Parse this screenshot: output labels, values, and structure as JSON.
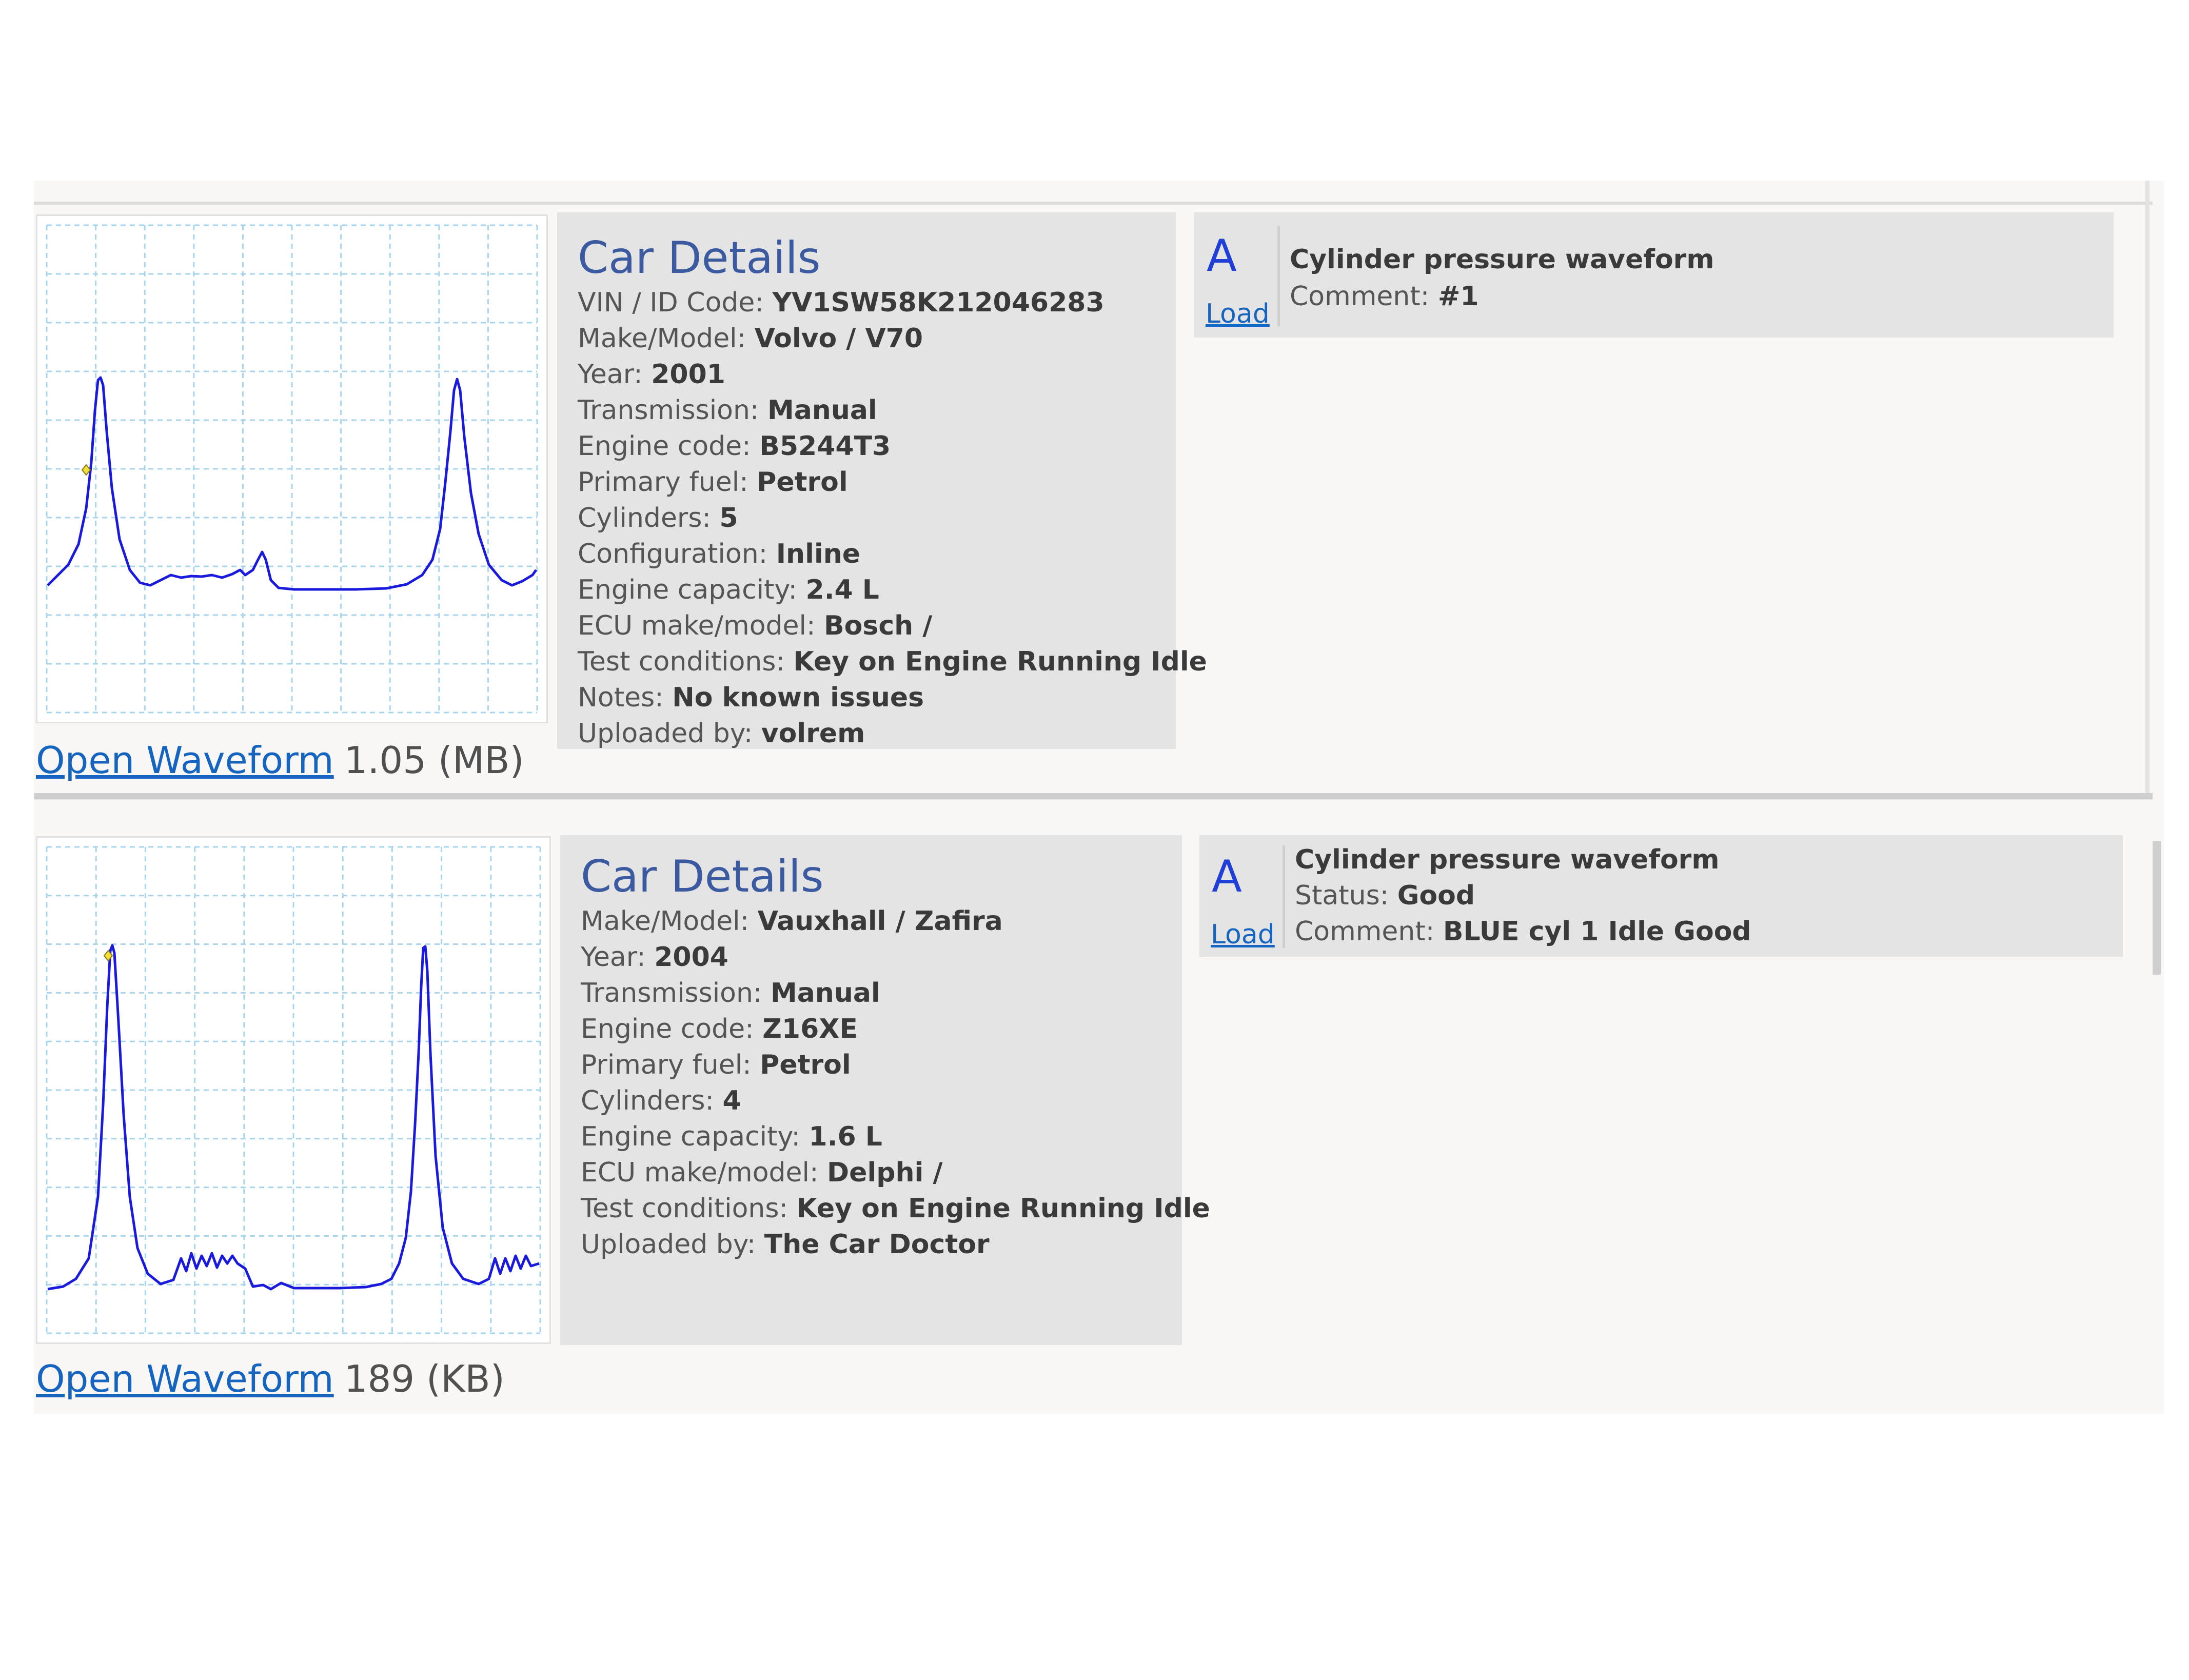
{
  "records": [
    {
      "waveform": {
        "open_label": "Open Waveform",
        "size": "1.05 (MB)"
      },
      "details": {
        "heading": "Car Details",
        "fields": [
          {
            "label": "VIN / ID Code:",
            "value": "YV1SW58K212046283"
          },
          {
            "label": "Make/Model:",
            "value": "Volvo / V70"
          },
          {
            "label": "Year:",
            "value": "2001"
          },
          {
            "label": "Transmission:",
            "value": "Manual"
          },
          {
            "label": "Engine code:",
            "value": "B5244T3"
          },
          {
            "label": "Primary fuel:",
            "value": "Petrol"
          },
          {
            "label": "Cylinders:",
            "value": "5"
          },
          {
            "label": "Configuration:",
            "value": "Inline"
          },
          {
            "label": "Engine capacity:",
            "value": "2.4 L"
          },
          {
            "label": "ECU make/model:",
            "value": "Bosch /"
          },
          {
            "label": "Test conditions:",
            "value": "Key on Engine Running Idle"
          },
          {
            "label": "Notes:",
            "value": "No known issues"
          },
          {
            "label": "Uploaded by:",
            "value": "volrem"
          }
        ]
      },
      "test": {
        "channel": "A",
        "load_label": "Load",
        "title": "Cylinder pressure waveform",
        "fields": [
          {
            "label": "Comment:",
            "value": "#1"
          }
        ]
      }
    },
    {
      "waveform": {
        "open_label": "Open Waveform",
        "size": "189 (KB)"
      },
      "details": {
        "heading": "Car Details",
        "fields": [
          {
            "label": "Make/Model:",
            "value": "Vauxhall / Zafira"
          },
          {
            "label": "Year:",
            "value": "2004"
          },
          {
            "label": "Transmission:",
            "value": "Manual"
          },
          {
            "label": "Engine code:",
            "value": "Z16XE"
          },
          {
            "label": "Primary fuel:",
            "value": "Petrol"
          },
          {
            "label": "Cylinders:",
            "value": "4"
          },
          {
            "label": "Engine capacity:",
            "value": "1.6 L"
          },
          {
            "label": "ECU make/model:",
            "value": "Delphi /"
          },
          {
            "label": "Test conditions:",
            "value": "Key on Engine Running Idle"
          },
          {
            "label": "Uploaded by:",
            "value": "The Car Doctor"
          }
        ]
      },
      "test": {
        "channel": "A",
        "load_label": "Load",
        "title": "Cylinder pressure waveform",
        "fields": [
          {
            "label": "Status:",
            "value": "Good"
          },
          {
            "label": "Comment:",
            "value": "BLUE cyl 1 Idle Good"
          }
        ]
      }
    }
  ],
  "colors": {
    "trace": "#1a1adc",
    "grid": "#a8d4ec",
    "marker": "#f2df3a",
    "link": "#1565c0",
    "heading": "#3c5aa0",
    "panel": "#e5e4e4"
  }
}
